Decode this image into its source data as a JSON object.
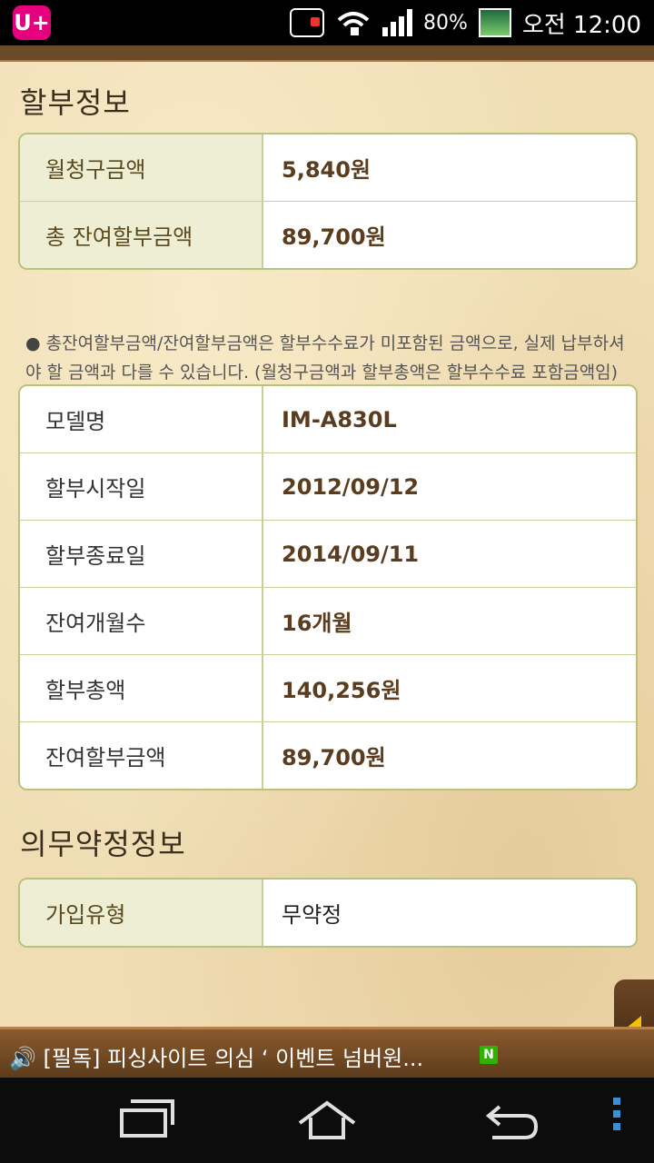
{
  "status_bar": {
    "carrier": "U+",
    "battery": "80%",
    "time": "오전 12:00"
  },
  "installment": {
    "title": "할부정보",
    "rows": [
      {
        "label": "월청구금액",
        "value": "5,840원"
      },
      {
        "label": "총 잔여할부금액",
        "value": "89,700원"
      }
    ],
    "note": "총잔여할부금액/잔여할부금액은 할부수수료가 미포함된 금액으로, 실제 납부하셔야 할 금액과 다를 수 있습니다. (월청구금액과 할부총액은 할부수수료 포함금액임)"
  },
  "details": {
    "rows": [
      {
        "label": "모델명",
        "value": "IM-A830L"
      },
      {
        "label": "할부시작일",
        "value": "2012/09/12"
      },
      {
        "label": "할부종료일",
        "value": "2014/09/11"
      },
      {
        "label": "잔여개월수",
        "value": "16개월"
      },
      {
        "label": "할부총액",
        "value": "140,256원"
      },
      {
        "label": "잔여할부금액",
        "value": "89,700원"
      }
    ]
  },
  "contract": {
    "title": "의무약정정보",
    "rows": [
      {
        "label": "가입유형",
        "value": "무약정"
      }
    ]
  },
  "ticker": {
    "text": "[필독] 피싱사이트 의심 ‘ 이벤트 넘버원...",
    "badge": "N"
  }
}
